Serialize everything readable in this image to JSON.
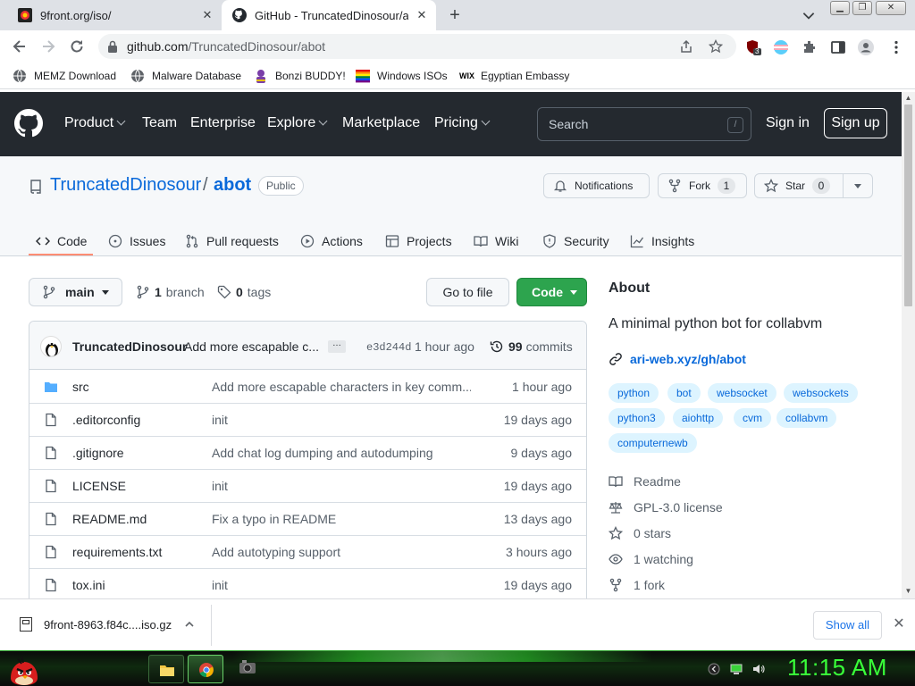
{
  "browser": {
    "tabs": [
      {
        "title": "9front.org/iso/",
        "icon": "9front-favicon",
        "active": false
      },
      {
        "title": "GitHub - TruncatedDinosour/abot",
        "icon": "github-favicon",
        "active": true
      }
    ],
    "url_host": "github.com",
    "url_path": "/TruncatedDinosour/abot",
    "extension_badge": "3",
    "bookmarks": [
      {
        "label": "MEMZ Download",
        "icon": "globe-icon"
      },
      {
        "label": "Malware Database",
        "icon": "globe-icon"
      },
      {
        "label": "Bonzi BUDDY!",
        "icon": "bonzi-icon"
      },
      {
        "label": "Windows ISOs",
        "icon": "windows-flag-icon"
      },
      {
        "label": "Egyptian Embassy",
        "icon": "wix-icon"
      }
    ]
  },
  "github": {
    "nav": [
      "Product",
      "Team",
      "Enterprise",
      "Explore",
      "Marketplace",
      "Pricing"
    ],
    "search_placeholder": "Search",
    "search_shortcut": "/",
    "sign_in": "Sign in",
    "sign_up": "Sign up"
  },
  "repo": {
    "owner": "TruncatedDinosour",
    "separator": "/",
    "name": "abot",
    "visibility": "Public",
    "notifications_label": "Notifications",
    "fork_label": "Fork",
    "fork_count": "1",
    "star_label": "Star",
    "star_count": "0",
    "tabs": [
      {
        "label": "Code",
        "icon": "code-icon"
      },
      {
        "label": "Issues",
        "icon": "issue-icon"
      },
      {
        "label": "Pull requests",
        "icon": "pull-request-icon"
      },
      {
        "label": "Actions",
        "icon": "play-icon"
      },
      {
        "label": "Projects",
        "icon": "table-icon"
      },
      {
        "label": "Wiki",
        "icon": "book-icon"
      },
      {
        "label": "Security",
        "icon": "shield-icon"
      },
      {
        "label": "Insights",
        "icon": "graph-icon"
      }
    ],
    "branch": "main",
    "branches_count": "1",
    "branches_label": "branch",
    "tags_count": "0",
    "tags_label": "tags",
    "go_to_file": "Go to file",
    "code_button": "Code",
    "latest_commit": {
      "author": "TruncatedDinosour",
      "message": "Add more escapable c...",
      "sha": "e3d244d",
      "time": "1 hour ago",
      "commits_count": "99",
      "commits_label": "commits"
    },
    "files": [
      {
        "name": "src",
        "type": "dir",
        "message": "Add more escapable characters in key comm...",
        "time": "1 hour ago"
      },
      {
        "name": ".editorconfig",
        "type": "file",
        "message": "init",
        "time": "19 days ago"
      },
      {
        "name": ".gitignore",
        "type": "file",
        "message": "Add chat log dumping and autodumping",
        "time": "9 days ago"
      },
      {
        "name": "LICENSE",
        "type": "file",
        "message": "init",
        "time": "19 days ago"
      },
      {
        "name": "README.md",
        "type": "file",
        "message": "Fix a typo in README",
        "time": "13 days ago"
      },
      {
        "name": "requirements.txt",
        "type": "file",
        "message": "Add autotyping support",
        "time": "3 hours ago"
      },
      {
        "name": "tox.ini",
        "type": "file",
        "message": "init",
        "time": "19 days ago"
      }
    ],
    "about": {
      "title": "About",
      "description": "A minimal python bot for collabvm",
      "website": "ari-web.xyz/gh/abot",
      "topics": [
        "python",
        "bot",
        "websocket",
        "websockets",
        "python3",
        "aiohttp",
        "cvm",
        "collabvm",
        "computernewb"
      ],
      "readme": "Readme",
      "license": "GPL-3.0 license",
      "stars": "0 stars",
      "watching": "1 watching",
      "forks": "1 fork"
    }
  },
  "download_shelf": {
    "filename": "9front-8963.f84c....iso.gz",
    "show_all": "Show all"
  },
  "taskbar": {
    "clock": "11:15 AM"
  },
  "colors": {
    "gh_header": "#24292f",
    "link_blue": "#0969da",
    "code_green": "#2da44e",
    "tab_underline": "#fd8c73",
    "clock_green": "#39ff39"
  }
}
